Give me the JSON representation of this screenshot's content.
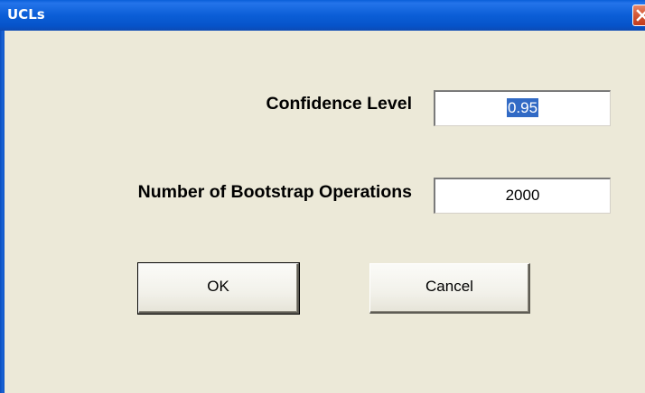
{
  "window": {
    "title": "UCLs"
  },
  "form": {
    "confidence_label": "Confidence Level",
    "confidence_value": "0.95",
    "bootstrap_label": "Number of Bootstrap Operations",
    "bootstrap_value": "2000"
  },
  "buttons": {
    "ok_label": "OK",
    "cancel_label": "Cancel"
  },
  "icons": {
    "close": "close-icon"
  },
  "colors": {
    "titlebar": "#0b5ed7",
    "dialog_background": "#ece9d8",
    "selection": "#316ac5",
    "close_button": "#d45a37"
  }
}
